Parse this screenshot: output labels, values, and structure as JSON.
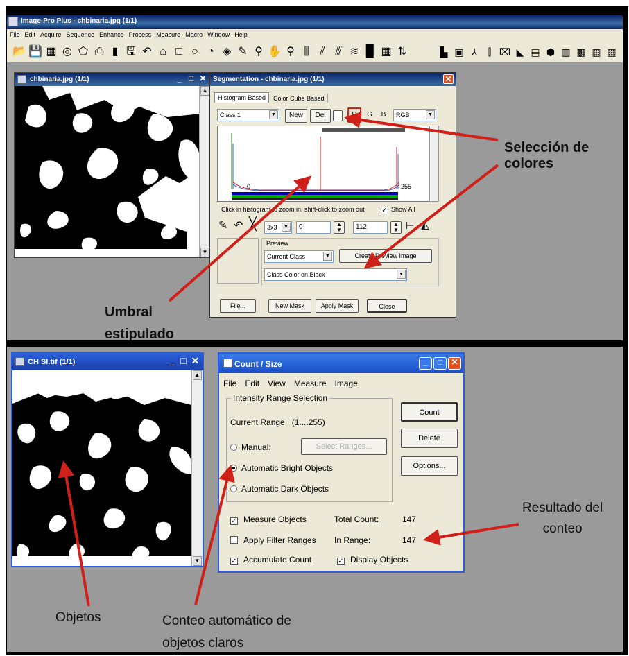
{
  "app": {
    "title": "Image-Pro Plus - chbinaria.jpg (1/1)",
    "menu": [
      "File",
      "Edit",
      "Acquire",
      "Sequence",
      "Enhance",
      "Process",
      "Measure",
      "Macro",
      "Window",
      "Help"
    ]
  },
  "toolbar_icons": [
    "open-icon",
    "save-icon",
    "grid-icon",
    "eye-icon",
    "polygon-icon",
    "print-icon",
    "paint-icon",
    "disk-icon",
    "undo-icon",
    "new-aoi-icon",
    "rect-icon",
    "circle-icon",
    "shape-icon",
    "fill-icon",
    "pen-icon",
    "zoom-icon",
    "hand-icon",
    "zoomout-icon",
    "histogram-icon",
    "profile-icon",
    "segment-icon",
    "count-icon",
    "chart-icon",
    "measure-icon",
    "map-icon"
  ],
  "top_image_window": {
    "title": "chbinaria.jpg (1/1)"
  },
  "segmentation": {
    "title": "Segmentation - chbinaria.jpg (1/1)",
    "tabs": [
      "Histogram Based",
      "Color Cube Based"
    ],
    "class_select": "Class 1",
    "new_label": "New",
    "del_label": "Del",
    "channels": [
      "R",
      "G",
      "B"
    ],
    "color_model": "RGB",
    "hist_min": "0",
    "hist_max": "255",
    "hint": "Click in histogram to zoom in, shift-click to zoom out",
    "show_all": "Show All",
    "kernel": "3x3",
    "low_value": "0",
    "high_value": "112",
    "preview_label": "Preview",
    "preview_mode": "Current Class",
    "create_preview": "Create Preview Image",
    "preview_color": "Class Color on Black",
    "buttons": {
      "file": "File...",
      "new_mask": "New Mask",
      "apply_mask": "Apply Mask",
      "close": "Close"
    }
  },
  "bottom_image_window": {
    "title": "CH SI.tif (1/1)"
  },
  "count_size": {
    "title": "Count / Size",
    "menu": [
      "File",
      "Edit",
      "View",
      "Measure",
      "Image"
    ],
    "group_title": "Intensity Range Selection",
    "current_range_label": "Current Range",
    "current_range_value": "(1....255)",
    "radio_manual": "Manual:",
    "select_ranges": "Select Ranges...",
    "radio_bright": "Automatic Bright Objects",
    "radio_dark": "Automatic Dark Objects",
    "buttons": {
      "count": "Count",
      "delete": "Delete",
      "options": "Options..."
    },
    "measure_objects": "Measure Objects",
    "apply_filter": "Apply Filter Ranges",
    "accumulate": "Accumulate Count",
    "display_objects": "Display Objects",
    "total_count_label": "Total Count:",
    "total_count_value": "147",
    "in_range_label": "In Range:",
    "in_range_value": "147"
  },
  "annotations": {
    "color_selection_1": "Selección de",
    "color_selection_2": "colores",
    "threshold_1": "Umbral",
    "threshold_2": "estipulado",
    "count_result_1": "Resultado del",
    "count_result_2": "conteo",
    "objects": "Objetos",
    "auto_count_1": "Conteo automático de",
    "auto_count_2": "objetos  claros"
  },
  "colors": {
    "arrow": "#d0201a",
    "titlebar": "#0a246a",
    "xp_title": "#2a5fd8",
    "close_red": "#e0501f"
  }
}
